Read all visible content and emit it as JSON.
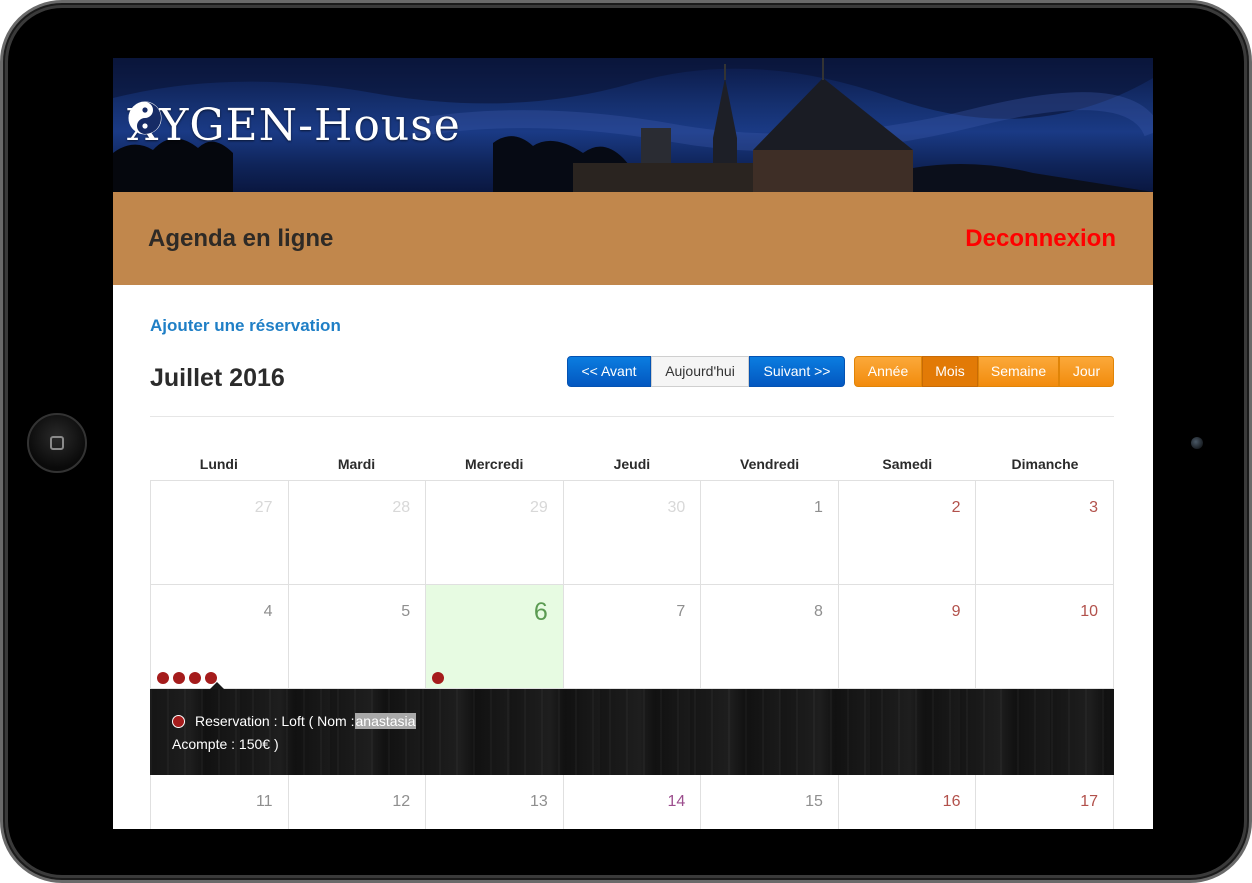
{
  "brand": {
    "logo_text": "XYGEN-House"
  },
  "header": {
    "title": "Agenda en ligne",
    "logout_label": "Deconnexion"
  },
  "actions": {
    "add_reservation": "Ajouter une réservation"
  },
  "calendar": {
    "month_title": "Juillet 2016",
    "nav": {
      "prev": "<< Avant",
      "today": "Aujourd'hui",
      "next": "Suivant >>"
    },
    "views": {
      "year": "Année",
      "month": "Mois",
      "week": "Semaine",
      "day": "Jour",
      "active": "Mois"
    },
    "weekdays": [
      "Lundi",
      "Mardi",
      "Mercredi",
      "Jeudi",
      "Vendredi",
      "Samedi",
      "Dimanche"
    ],
    "weeks": [
      {
        "days": [
          {
            "n": "27",
            "type": "out"
          },
          {
            "n": "28",
            "type": "out"
          },
          {
            "n": "29",
            "type": "out"
          },
          {
            "n": "30",
            "type": "out"
          },
          {
            "n": "1",
            "type": "normal"
          },
          {
            "n": "2",
            "type": "weekend"
          },
          {
            "n": "3",
            "type": "weekend"
          }
        ]
      },
      {
        "days": [
          {
            "n": "4",
            "type": "normal",
            "events": 4
          },
          {
            "n": "5",
            "type": "normal"
          },
          {
            "n": "6",
            "type": "today",
            "events": 1
          },
          {
            "n": "7",
            "type": "normal"
          },
          {
            "n": "8",
            "type": "normal"
          },
          {
            "n": "9",
            "type": "weekend"
          },
          {
            "n": "10",
            "type": "weekend"
          }
        ]
      },
      {
        "days": [
          {
            "n": "11",
            "type": "normal"
          },
          {
            "n": "12",
            "type": "normal"
          },
          {
            "n": "13",
            "type": "normal"
          },
          {
            "n": "14",
            "type": "holiday"
          },
          {
            "n": "15",
            "type": "normal"
          },
          {
            "n": "16",
            "type": "weekend"
          },
          {
            "n": "17",
            "type": "weekend"
          }
        ]
      }
    ],
    "event_detail": {
      "line1_prefix": "Reservation : Loft ( Nom : ",
      "name": "anastasia",
      "line2": "Acompte : 150€ )"
    }
  },
  "colors": {
    "topbar": "#c1874c",
    "logout": "#ff0000",
    "link": "#1f7fc6",
    "nav_blue": "#0b7de0",
    "view_orange": "#f9a02c",
    "event_dot": "#a51c1c",
    "today_bg": "#e7fbe2"
  }
}
